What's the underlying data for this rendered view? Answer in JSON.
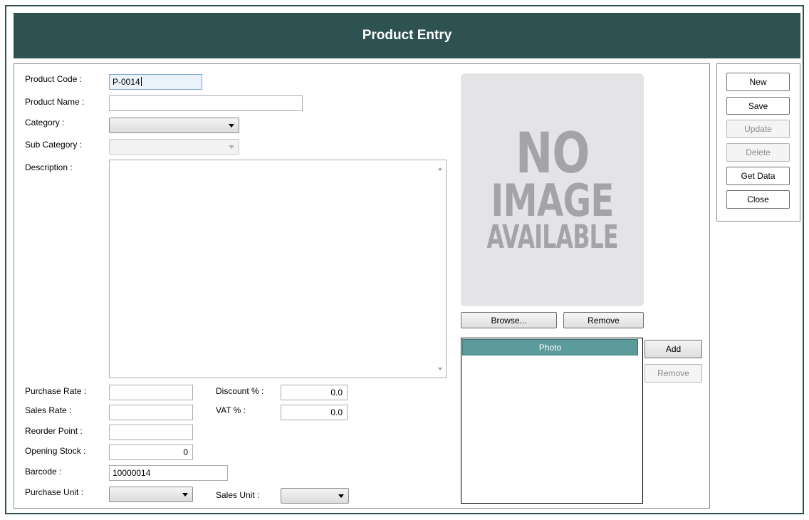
{
  "window": {
    "title": "Product Entry"
  },
  "form": {
    "product_code": {
      "label": "Product Code :",
      "value": "P-0014"
    },
    "product_name": {
      "label": "Product Name :",
      "value": ""
    },
    "category": {
      "label": "Category :",
      "value": ""
    },
    "sub_category": {
      "label": "Sub Category :",
      "value": ""
    },
    "description": {
      "label": "Description :",
      "value": ""
    },
    "purchase_rate": {
      "label": "Purchase Rate :",
      "value": ""
    },
    "sales_rate": {
      "label": "Sales Rate :",
      "value": ""
    },
    "reorder_point": {
      "label": "Reorder Point :",
      "value": ""
    },
    "opening_stock": {
      "label": "Opening Stock :",
      "value": "0"
    },
    "barcode": {
      "label": "Barcode :",
      "value": "10000014"
    },
    "purchase_unit": {
      "label": "Purchase Unit :",
      "value": ""
    },
    "discount": {
      "label": "Discount % :",
      "value": "0.0"
    },
    "vat": {
      "label": "VAT % :",
      "value": "0.0"
    },
    "sales_unit": {
      "label": "Sales Unit :",
      "value": ""
    }
  },
  "image": {
    "placeholder_lines": [
      "NO",
      "IMAGE",
      "AVAILABLE"
    ],
    "browse_label": "Browse...",
    "remove_label": "Remove"
  },
  "photos": {
    "column_header": "Photo",
    "add_label": "Add",
    "remove_label": "Remove"
  },
  "actions": {
    "new_label": "New",
    "save_label": "Save",
    "update_label": "Update",
    "delete_label": "Delete",
    "get_data_label": "Get Data",
    "close_label": "Close"
  },
  "colors": {
    "title_bar": "#2e5151",
    "grid_header": "#5b9b9b"
  }
}
